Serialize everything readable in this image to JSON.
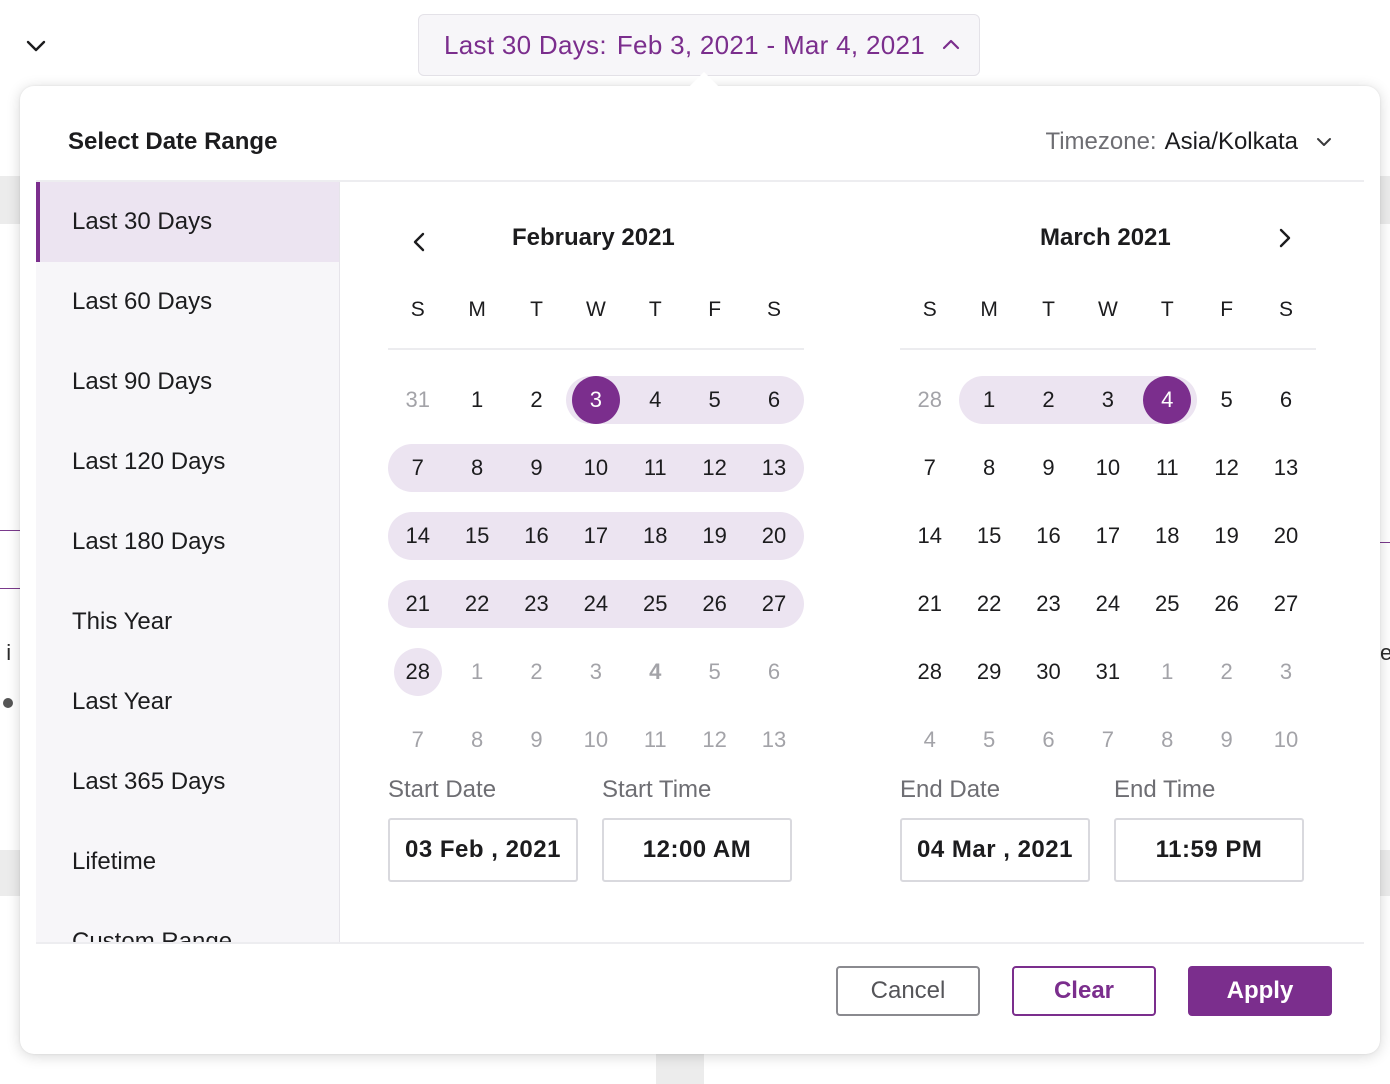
{
  "trigger": {
    "prefix": "Last 30 Days:",
    "range": "Feb 3, 2021 - Mar 4, 2021"
  },
  "panel": {
    "title": "Select Date Range",
    "timezone_label": "Timezone:",
    "timezone_value": "Asia/Kolkata"
  },
  "presets": [
    "Last 30 Days",
    "Last 60 Days",
    "Last 90 Days",
    "Last 120 Days",
    "Last 180 Days",
    "This Year",
    "Last Year",
    "Last 365 Days",
    "Lifetime",
    "Custom Range"
  ],
  "active_preset": 0,
  "weekdays": [
    "S",
    "M",
    "T",
    "W",
    "T",
    "F",
    "S"
  ],
  "calendars": [
    {
      "title": "February 2021",
      "weeks": [
        [
          "31",
          "1",
          "2",
          "3",
          "4",
          "5",
          "6"
        ],
        [
          "7",
          "8",
          "9",
          "10",
          "11",
          "12",
          "13"
        ],
        [
          "14",
          "15",
          "16",
          "17",
          "18",
          "19",
          "20"
        ],
        [
          "21",
          "22",
          "23",
          "24",
          "25",
          "26",
          "27"
        ],
        [
          "28",
          "1",
          "2",
          "3",
          "4",
          "5",
          "6"
        ],
        [
          "7",
          "8",
          "9",
          "10",
          "11",
          "12",
          "13"
        ]
      ]
    },
    {
      "title": "March 2021",
      "weeks": [
        [
          "28",
          "1",
          "2",
          "3",
          "4",
          "5",
          "6"
        ],
        [
          "7",
          "8",
          "9",
          "10",
          "11",
          "12",
          "13"
        ],
        [
          "14",
          "15",
          "16",
          "17",
          "18",
          "19",
          "20"
        ],
        [
          "21",
          "22",
          "23",
          "24",
          "25",
          "26",
          "27"
        ],
        [
          "28",
          "29",
          "30",
          "31",
          "1",
          "2",
          "3"
        ],
        [
          "4",
          "5",
          "6",
          "7",
          "8",
          "9",
          "10"
        ]
      ]
    }
  ],
  "fields": {
    "start_date_label": "Start Date",
    "start_date": "03 Feb , 2021",
    "start_time_label": "Start Time",
    "start_time": "12:00 AM",
    "end_date_label": "End Date",
    "end_date": "04 Mar , 2021",
    "end_time_label": "End Time",
    "end_time": "11:59 PM"
  },
  "buttons": {
    "cancel": "Cancel",
    "clear": "Clear",
    "apply": "Apply"
  },
  "colors": {
    "accent": "#7b2e8d",
    "range_fill": "#ece4f1",
    "muted_text": "#a3a3a8"
  },
  "background": {
    "left_fragment": "t i",
    "right_fragment": "e"
  }
}
